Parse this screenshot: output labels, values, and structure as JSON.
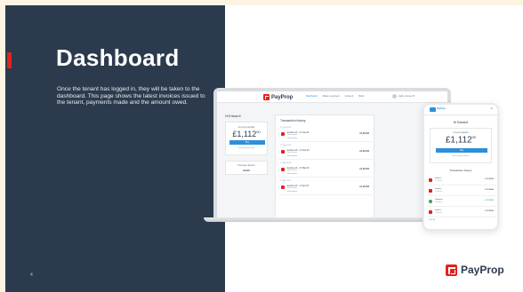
{
  "slide": {
    "title": "Dashboard",
    "description": "Once the tenant has logged in, they will be taken to the dashboard. This page shows the latest invoices issued to the tenant, payments made and the amount owed.",
    "page_number": "4",
    "brand_name": "PayProp"
  },
  "laptop": {
    "logo_text": "PayProp",
    "nav_links": [
      "Dashboard",
      "Make a payment",
      "Account",
      "Refer"
    ],
    "user_label": "Hello, James M",
    "heading": "Hi Edward!",
    "balance_label": "Amount payable",
    "balance_amount": "£1,112",
    "balance_pence": "00",
    "pay_button": "Pay",
    "balance_link": "View payment details",
    "deposit_label": "Damage deposit",
    "deposit_value": "£0.00",
    "transactions_title": "Transaction history",
    "transactions": [
      {
        "group": "17 Jan 2023",
        "title": "Invoice 1/1 - 17 Jan 23",
        "sub": "Rent invoice",
        "amount": "£1,112.00",
        "link": "View invoice"
      },
      {
        "group": "17 Feb 2023",
        "title": "Invoice 1/1 - 17 Feb 23",
        "sub": "Rent invoice",
        "amount": "£1,112.00",
        "link": "View invoice"
      },
      {
        "group": "17 Mar 2023",
        "title": "Invoice 1/1 - 17 Mar 23",
        "sub": "Rent invoice",
        "amount": "£1,112.00",
        "link": "View invoice"
      },
      {
        "group": "17 Apr 2023",
        "title": "Invoice 1/1 - 17 Apr 23",
        "sub": "Rent invoice",
        "amount": "£1,112.00",
        "link": "View invoice"
      }
    ]
  },
  "phone": {
    "brand": "PayProp",
    "heading": "Hi Edward!",
    "balance_label": "Amount payable",
    "balance_amount": "£1,112",
    "balance_pence": "00",
    "pay_button": "Pay",
    "balance_link": "View payment details",
    "transactions_title": "Transaction history",
    "transactions": [
      {
        "title": "Invoice",
        "sub": "17 Jan 23",
        "amount": "£1,112.00",
        "kind": "invoice"
      },
      {
        "title": "Invoice",
        "sub": "17 Feb 23",
        "amount": "£1,112.00",
        "kind": "invoice"
      },
      {
        "title": "Payment",
        "sub": "17 Feb 23",
        "amount": "£1,112.00",
        "kind": "payment"
      },
      {
        "title": "Invoice",
        "sub": "17 Mar 23",
        "amount": "£1,112.00",
        "kind": "invoice"
      }
    ],
    "more_link": "View all"
  },
  "colors": {
    "panel": "#2b3a4d",
    "accent": "#e2231a",
    "link": "#2e8fd8"
  }
}
